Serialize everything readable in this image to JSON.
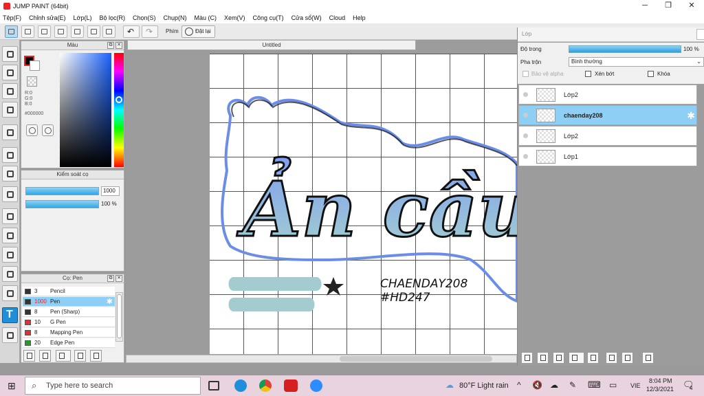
{
  "window": {
    "title": "JUMP PAINT (64bit)"
  },
  "menu": [
    "Tệp(F)",
    "Chỉnh sửa(E)",
    "Lớp(L)",
    "Bộ lọc(R)",
    "Chọn(S)",
    "Chụp(N)",
    "Màu (C)",
    "Xem(V)",
    "Công cụ(T)",
    "Cửa sổ(W)",
    "Cloud",
    "Help"
  ],
  "toolbar": {
    "phim_label": "Phím",
    "dat_lai_label": "Đặt lại"
  },
  "color_panel": {
    "title": "Màu",
    "r": "R:0",
    "g": "G:0",
    "b": "B:0",
    "hex": "#000000"
  },
  "brush_control": {
    "title": "Kiểm soát cọ",
    "size": "1000",
    "opacity": "100 %"
  },
  "brush_panel": {
    "title": "Cọ: Pen",
    "brushes": [
      {
        "size": "3",
        "name": "Pencil",
        "color": "#333333"
      },
      {
        "size": "1000",
        "name": "Pen",
        "color": "#333333"
      },
      {
        "size": "8",
        "name": "Pen (Sharp)",
        "color": "#333333"
      },
      {
        "size": "10",
        "name": "G Pen",
        "color": "#e03030"
      },
      {
        "size": "8",
        "name": "Mapping Pen",
        "color": "#e03030"
      },
      {
        "size": "20",
        "name": "Edge Pen",
        "color": "#20a020"
      }
    ]
  },
  "document": {
    "tab_title": "Untitled",
    "artwork_text": "Ản cầu",
    "signature_line1": "CHAENDAY208",
    "signature_line2": "#HD247"
  },
  "layer_panel": {
    "title": "Lớp",
    "opacity_label": "Độ trong",
    "opacity_value": "100 %",
    "blend_label": "Pha trộn",
    "blend_value": "Bình thường",
    "protect_alpha": "Bảo vệ alpha",
    "clipping": "Xén bớt",
    "lock": "Khóa",
    "layers": [
      {
        "name": "Lớp2"
      },
      {
        "name": "chaenday208"
      },
      {
        "name": "Lớp2"
      },
      {
        "name": "Lớp1"
      }
    ]
  },
  "taskbar": {
    "search_placeholder": "Type here to search",
    "weather": "80°F  Light rain",
    "lang": "VIE",
    "time": "8:04 PM",
    "date": "12/3/2021",
    "notif": "4"
  },
  "colors": {
    "accent": "#8ecff6",
    "brush_outline": "#6b8de8",
    "brush_fill_end": "#9cc8cf"
  }
}
